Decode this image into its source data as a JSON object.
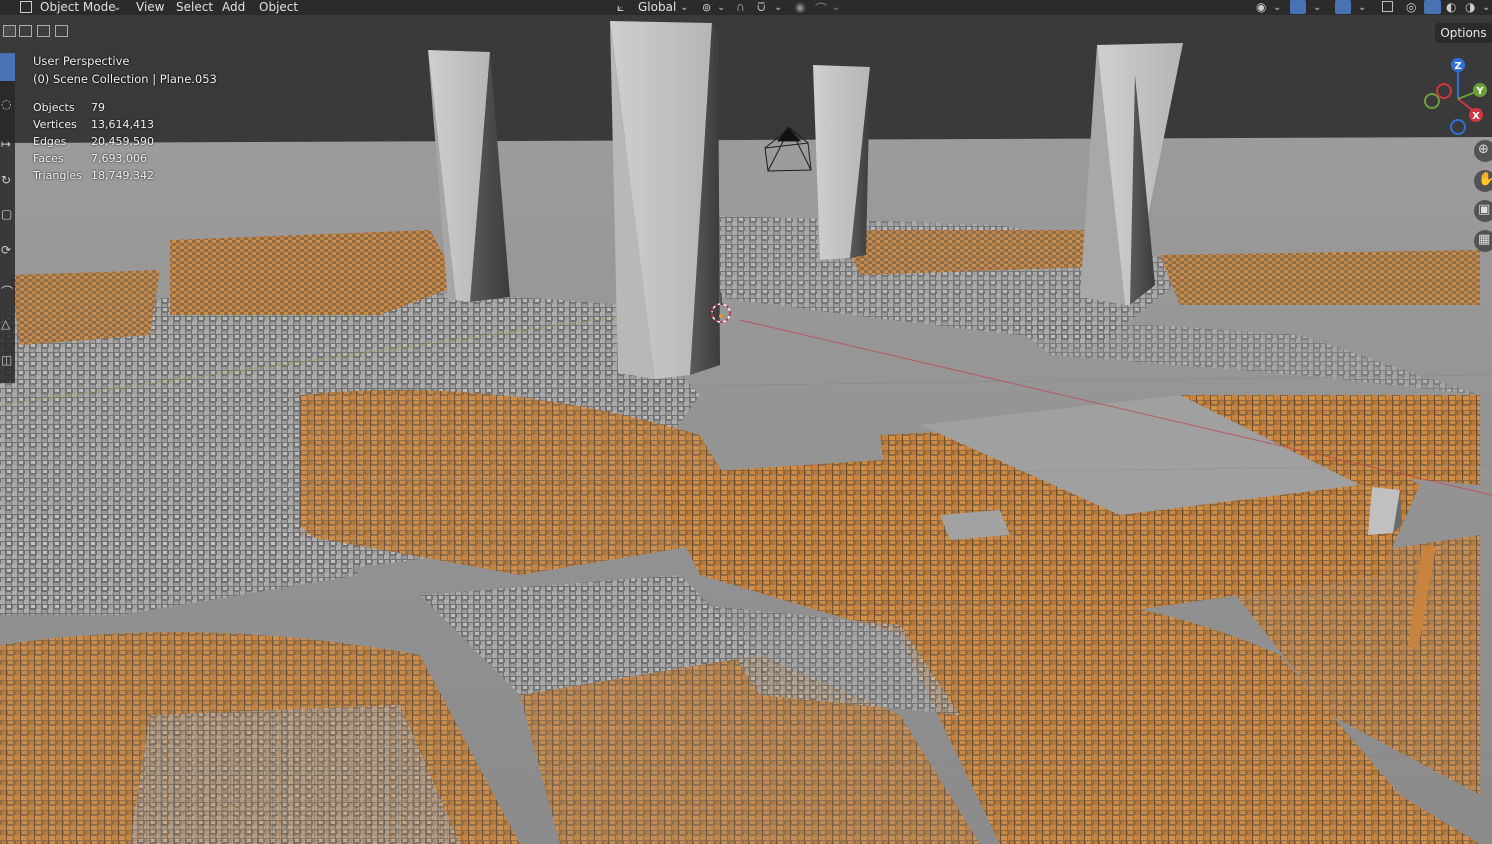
{
  "header": {
    "mode_label": "Object Mode",
    "menu": [
      "View",
      "Select",
      "Add",
      "Object"
    ],
    "transform_orientation": "Global",
    "options_label": "Options"
  },
  "overlay": {
    "view_name": "User Perspective",
    "collection_info": "(0) Scene Collection | Plane.053",
    "stats": [
      {
        "label": "Objects",
        "value": "79"
      },
      {
        "label": "Vertices",
        "value": "13,614,413"
      },
      {
        "label": "Edges",
        "value": "20,459,590"
      },
      {
        "label": "Faces",
        "value": "7,693,006"
      },
      {
        "label": "Triangles",
        "value": "18,749,342"
      }
    ]
  },
  "gizmo": {
    "x_label": "X",
    "y_label": "Y",
    "z_label": "Z"
  },
  "colors": {
    "header_bg": "#2b2b2b",
    "horizon_bg": "#3a3a3a",
    "ground": "#8a8a8a",
    "building_orange": "#c7833f",
    "building_gray": "#9a9a9a",
    "tower": "#bdbdbd",
    "active_tool": "#4772b3",
    "axis_x": "#d0353f",
    "axis_y": "#6ba03a",
    "axis_z": "#2f6fd8"
  },
  "icons": [
    "object-mode-icon",
    "transform-orientation-icon",
    "pivot-icon",
    "snap-icon",
    "proportional-edit-icon",
    "visibility-icon",
    "gizmo-icon",
    "overlay-icon",
    "xray-icon",
    "wireframe-shading-icon",
    "solid-shading-icon",
    "material-shading-icon",
    "rendered-shading-icon",
    "zoom-icon",
    "pan-hand-icon",
    "camera-icon",
    "grid-icon"
  ]
}
